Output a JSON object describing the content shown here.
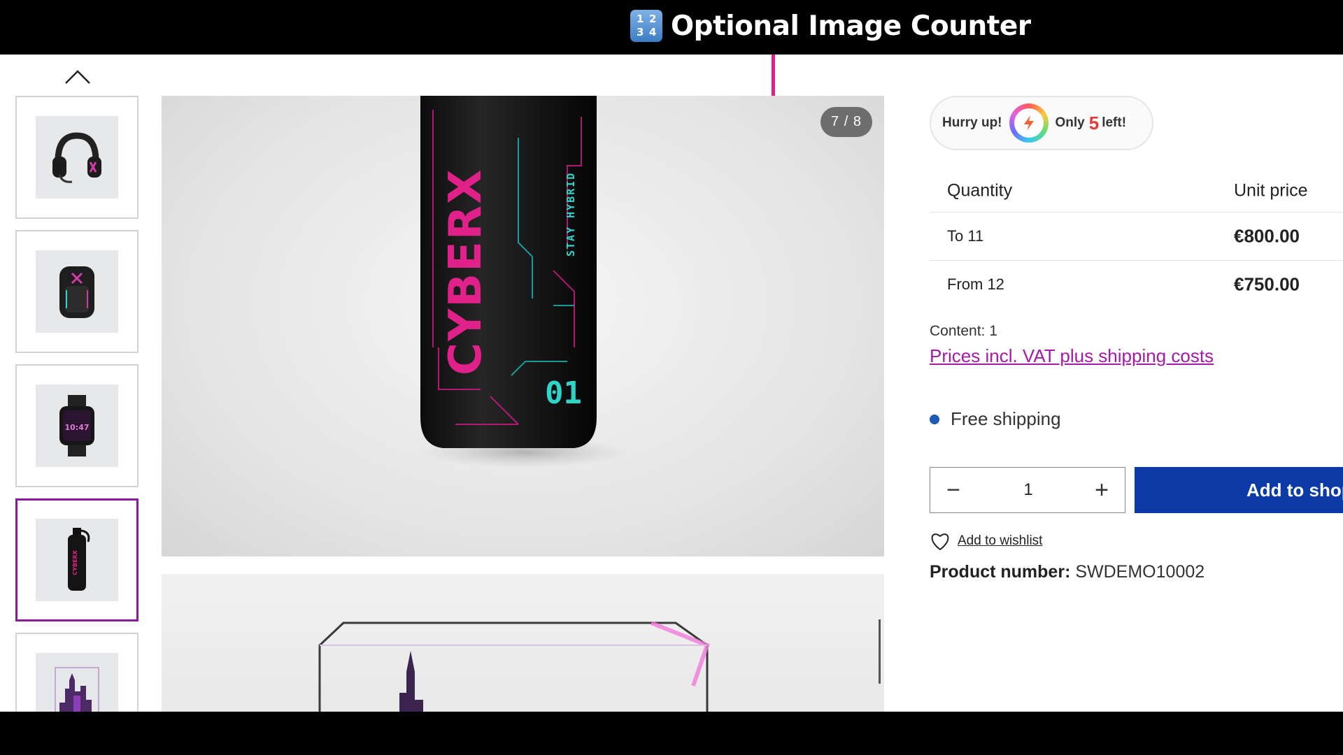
{
  "annotation": {
    "title": "Optional Image Counter",
    "icon": "input-numbers-icon",
    "icon_digits": [
      "1",
      "2",
      "3",
      "4"
    ],
    "accent_color": "#e0218a"
  },
  "gallery": {
    "counter": "7 / 8",
    "main_image_brand": "CYBERX",
    "main_image_tagline": "STAY HYBRID",
    "main_image_number": "01",
    "thumbnails": [
      {
        "name": "headset",
        "active": false
      },
      {
        "name": "backpack",
        "active": false
      },
      {
        "name": "smartwatch",
        "active": false,
        "time": "10:47"
      },
      {
        "name": "bottle",
        "active": true
      },
      {
        "name": "city-display",
        "active": false
      }
    ]
  },
  "stock": {
    "prefix": "Hurry up!",
    "only": "Only",
    "count": "5",
    "suffix": "left!"
  },
  "price_table": {
    "headers": [
      "Quantity",
      "Unit price"
    ],
    "rows": [
      {
        "quantity": "To 11",
        "price": "€800.00"
      },
      {
        "quantity": "From 12",
        "price": "€750.00"
      }
    ]
  },
  "content_info": "Content: 1",
  "vat_link": "Prices incl. VAT plus shipping costs",
  "shipping": "Free shipping",
  "quantity": {
    "value": "1",
    "minus": "−",
    "plus": "+"
  },
  "add_to_cart": "Add to shopping cart",
  "wishlist": "Add to wishlist",
  "product_number": {
    "label": "Product number:",
    "value": "SWDEMO10002"
  },
  "colors": {
    "brand_blue": "#0b3aa6",
    "link_purple": "#a61aa8",
    "active_thumb": "#8a1a9b",
    "shipping_dot": "#1a5bb5",
    "stock_red": "#e23a3a"
  }
}
